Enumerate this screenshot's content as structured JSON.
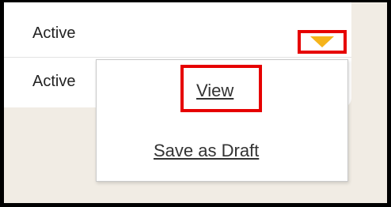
{
  "rows": [
    {
      "status": "Active"
    },
    {
      "status": "Active"
    }
  ],
  "dropdown": {
    "toggle_icon": "caret-down-icon",
    "toggle_color": "#f5b41b",
    "highlight_color": "#e60000",
    "items": [
      {
        "label": "View"
      },
      {
        "label": "Save as Draft"
      }
    ]
  }
}
